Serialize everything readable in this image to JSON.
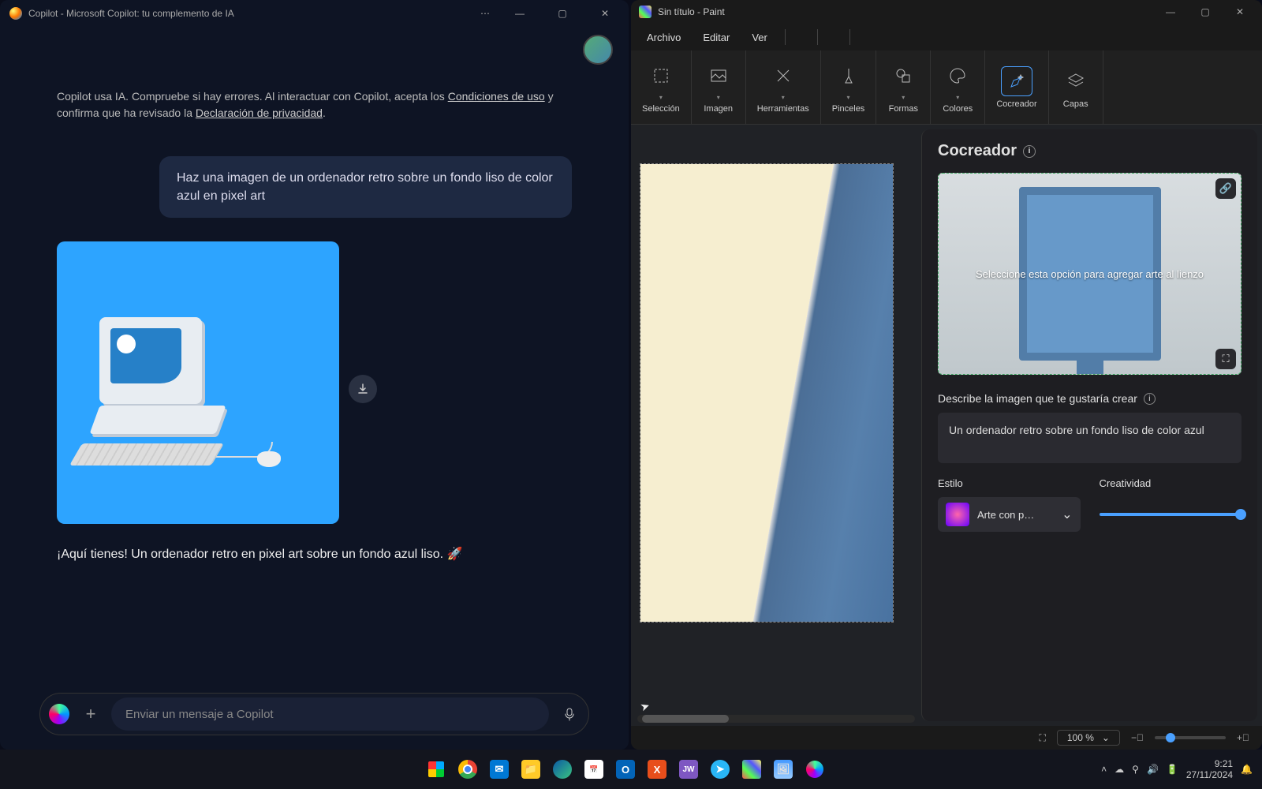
{
  "copilot": {
    "title": "Copilot - Microsoft Copilot: tu complemento de IA",
    "disclaimer_pre": "Copilot usa IA. Compruebe si hay errores. Al interactuar con Copilot, acepta los ",
    "disclaimer_link1": "Condiciones de uso",
    "disclaimer_mid": " y confirma que ha revisado la ",
    "disclaimer_link2": "Declaración de privacidad",
    "user_message": "Haz una imagen de un ordenador retro sobre un fondo liso de color azul en pixel art",
    "response_text": "¡Aquí tienes! Un ordenador retro en pixel art sobre un fondo azul liso. 🚀",
    "input_placeholder": "Enviar un mensaje a Copilot"
  },
  "paint": {
    "title": "Sin título - Paint",
    "menu": {
      "file": "Archivo",
      "edit": "Editar",
      "view": "Ver"
    },
    "ribbon": {
      "selection": "Selección",
      "image": "Imagen",
      "tools": "Herramientas",
      "brushes": "Pinceles",
      "shapes": "Formas",
      "colors": "Colores",
      "cocreator": "Cocreador",
      "layers": "Capas"
    },
    "cocreator": {
      "title": "Cocreador",
      "preview_text": "Seleccione esta opción para agregar arte al lienzo",
      "describe_label": "Describe la imagen que te gustaría crear",
      "prompt": "Un ordenador retro sobre un fondo liso de color azul",
      "style_label": "Estilo",
      "style_value": "Arte con p…",
      "creativity_label": "Creatividad"
    },
    "zoom": "100 %"
  },
  "system": {
    "time": "9:21",
    "date": "27/11/2024"
  }
}
